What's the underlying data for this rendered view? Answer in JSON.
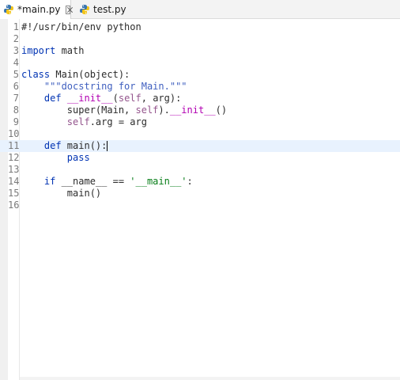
{
  "tabs": [
    {
      "label": "*main.py",
      "active": true,
      "icon": "python-file-icon"
    },
    {
      "label": "test.py",
      "active": false,
      "icon": "python-file-icon"
    }
  ],
  "colors": {
    "keyword": "#0033b3",
    "self": "#94558d",
    "string": "#067d17",
    "docstring": "#3f5fbf",
    "magic": "#b200b2",
    "current_line": "#e8f2fe"
  },
  "editor": {
    "current_line": 11,
    "lines": [
      {
        "num": "1",
        "parts": [
          {
            "t": "#!/usr/bin/env python",
            "c": "plain"
          }
        ]
      },
      {
        "num": "2",
        "parts": []
      },
      {
        "num": "3",
        "parts": [
          {
            "t": "import",
            "c": "kw"
          },
          {
            "t": " math",
            "c": "plain"
          }
        ]
      },
      {
        "num": "4",
        "parts": []
      },
      {
        "num": "5",
        "parts": [
          {
            "t": "class",
            "c": "kw"
          },
          {
            "t": " Main(object):",
            "c": "plain"
          }
        ]
      },
      {
        "num": "6",
        "parts": [
          {
            "t": "    \"\"\"",
            "c": "doc"
          },
          {
            "t": "docstring for Main.",
            "c": "doc"
          },
          {
            "t": "\"\"\"",
            "c": "doc"
          }
        ]
      },
      {
        "num": "7",
        "parts": [
          {
            "t": "    def",
            "c": "kw"
          },
          {
            "t": " ",
            "c": "plain"
          },
          {
            "t": "__init__",
            "c": "magic"
          },
          {
            "t": "(",
            "c": "plain"
          },
          {
            "t": "self",
            "c": "self"
          },
          {
            "t": ", arg):",
            "c": "plain"
          }
        ]
      },
      {
        "num": "8",
        "parts": [
          {
            "t": "        super(Main, ",
            "c": "plain"
          },
          {
            "t": "self",
            "c": "self"
          },
          {
            "t": ").",
            "c": "plain"
          },
          {
            "t": "__init__",
            "c": "magic"
          },
          {
            "t": "()",
            "c": "plain"
          }
        ]
      },
      {
        "num": "9",
        "parts": [
          {
            "t": "        ",
            "c": "plain"
          },
          {
            "t": "self",
            "c": "self"
          },
          {
            "t": ".arg = arg",
            "c": "plain"
          }
        ]
      },
      {
        "num": "10",
        "parts": []
      },
      {
        "num": "11",
        "parts": [
          {
            "t": "    def",
            "c": "kw"
          },
          {
            "t": " main():",
            "c": "plain"
          }
        ]
      },
      {
        "num": "12",
        "parts": [
          {
            "t": "        pass",
            "c": "kw"
          }
        ]
      },
      {
        "num": "13",
        "parts": []
      },
      {
        "num": "14",
        "parts": [
          {
            "t": "    if",
            "c": "kw"
          },
          {
            "t": " __name__ == ",
            "c": "plain"
          },
          {
            "t": "'__main__'",
            "c": "str"
          },
          {
            "t": ":",
            "c": "plain"
          }
        ]
      },
      {
        "num": "15",
        "parts": [
          {
            "t": "        main()",
            "c": "plain"
          }
        ]
      },
      {
        "num": "16",
        "parts": []
      }
    ]
  }
}
